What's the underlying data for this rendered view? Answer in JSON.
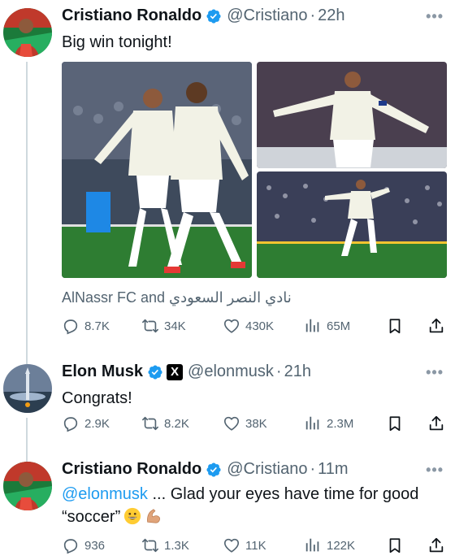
{
  "tweets": [
    {
      "name": "Cristiano Ronaldo",
      "handle": "@Cristiano",
      "time": "22h",
      "text": "Big win tonight!",
      "caption": "AlNassr FC and نادي النصر السعودي",
      "stats": {
        "replies": "8.7K",
        "retweets": "34K",
        "likes": "430K",
        "views": "65M"
      },
      "avatar_icon": "player-avatar-icon"
    },
    {
      "name": "Elon Musk",
      "handle": "@elonmusk",
      "time": "21h",
      "text": "Congrats!",
      "badge_letter": "X",
      "stats": {
        "replies": "2.9K",
        "retweets": "8.2K",
        "likes": "38K",
        "views": "2.3M"
      },
      "avatar_icon": "rocket-avatar-icon"
    },
    {
      "name": "Cristiano Ronaldo",
      "handle": "@Cristiano",
      "time": "11m",
      "mention": "@elonmusk",
      "text_line1": " ... Glad your eyes have time for good",
      "text_line2": "“soccer”",
      "emojis": [
        "grinning-face-emoji",
        "flexed-biceps-emoji"
      ],
      "stats": {
        "replies": "936",
        "retweets": "1.3K",
        "likes": "11K",
        "views": "122K"
      },
      "avatar_icon": "player-avatar-icon"
    }
  ],
  "dot_separator": "·",
  "more_label": "•••",
  "colors": {
    "accent": "#1d9bf0",
    "muted": "#536471",
    "text": "#0f1419",
    "pitch": "#2e7d32"
  }
}
